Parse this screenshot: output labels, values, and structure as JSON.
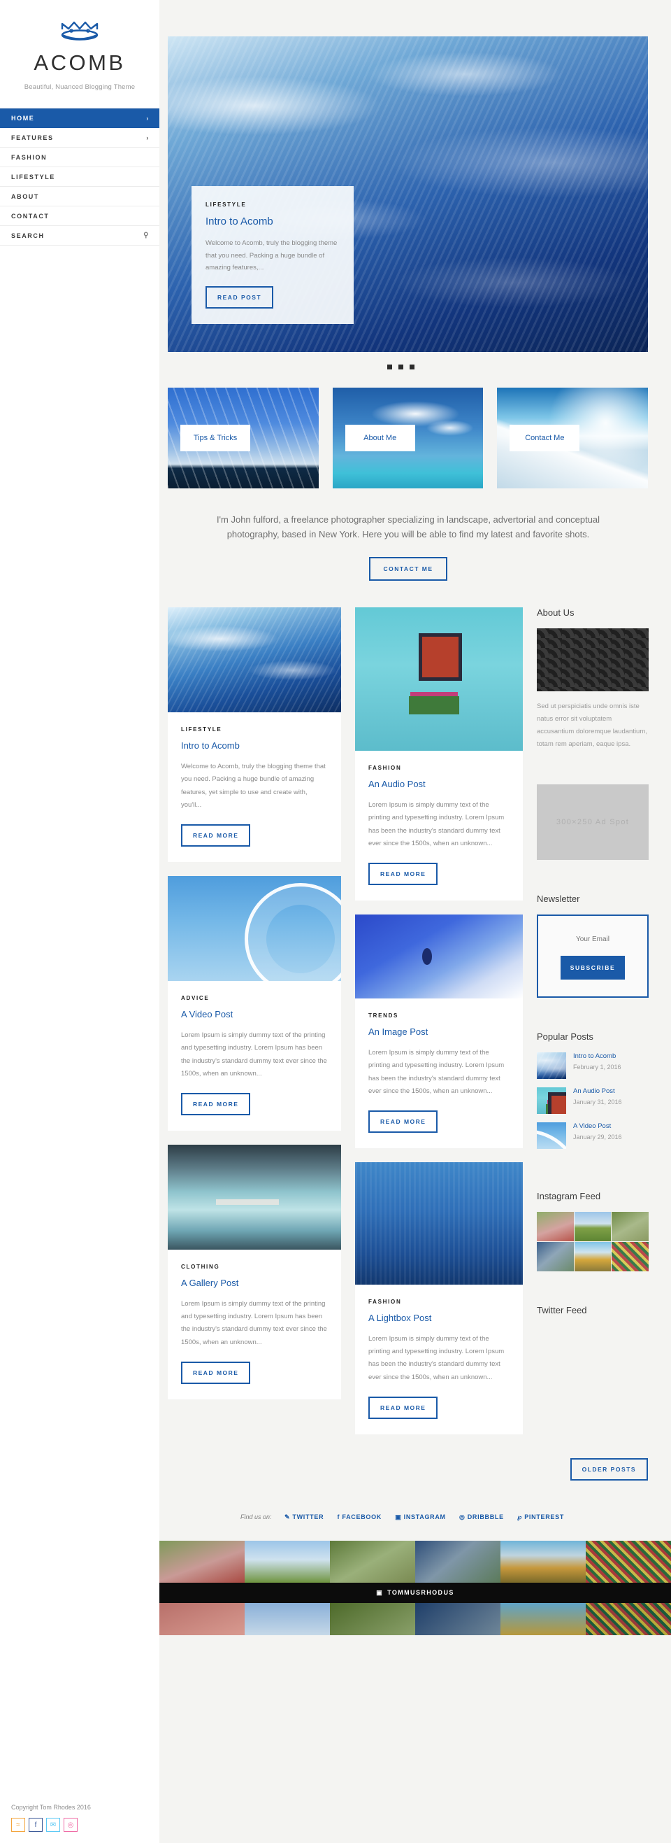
{
  "brand": {
    "title": "ACOMB",
    "tagline": "Beautiful, Nuanced Blogging Theme",
    "logo_icon": "crown-icon"
  },
  "nav": {
    "items": [
      {
        "label": "HOME",
        "active": true,
        "chevron": "›"
      },
      {
        "label": "FEATURES",
        "active": false,
        "chevron": "›"
      },
      {
        "label": "FASHION",
        "active": false,
        "chevron": ""
      },
      {
        "label": "LIFESTYLE",
        "active": false,
        "chevron": ""
      },
      {
        "label": "ABOUT",
        "active": false,
        "chevron": ""
      },
      {
        "label": "CONTACT",
        "active": false,
        "chevron": ""
      },
      {
        "label": "SEARCH",
        "active": false,
        "chevron": "",
        "icon": "search-icon"
      }
    ]
  },
  "hero": {
    "category": "LIFESTYLE",
    "title": "Intro to Acomb",
    "excerpt": "Welcome to Acomb, truly the blogging theme that you need. Packing a huge bundle of amazing features,...",
    "button": "READ POST",
    "dots": 3
  },
  "features": [
    {
      "label": "Tips & Tricks"
    },
    {
      "label": "About Me"
    },
    {
      "label": "Contact Me"
    }
  ],
  "intro": {
    "text": "I'm John fulford, a freelance photographer specializing in landscape, advertorial and conceptual photography, based in New York. Here you will be able to find my latest and favorite shots.",
    "button": "CONTACT ME"
  },
  "posts": {
    "column_a": [
      {
        "category": "LIFESTYLE",
        "title": "Intro to Acomb",
        "excerpt": "Welcome to Acomb, truly the blogging theme that you need. Packing a huge bundle of amazing features, yet simple to use and create with, you'll...",
        "button": "READ MORE",
        "image": "ocean-waves"
      },
      {
        "category": "ADVICE",
        "title": "A Video Post",
        "excerpt": "Lorem Ipsum is simply dummy text of the printing and typesetting industry. Lorem Ipsum has been the industry's standard dummy text ever since the 1500s, when an unknown...",
        "button": "READ MORE",
        "image": "ferris-wheel"
      },
      {
        "category": "CLOTHING",
        "title": "A Gallery Post",
        "excerpt": "Lorem Ipsum is simply dummy text of the printing and typesetting industry. Lorem Ipsum has been the industry's standard dummy text ever since the 1500s, when an unknown...",
        "button": "READ MORE",
        "image": "blue-lagoon"
      }
    ],
    "column_b": [
      {
        "category": "FASHION",
        "title": "An Audio Post",
        "excerpt": "Lorem Ipsum is simply dummy text of the printing and typesetting industry. Lorem Ipsum has been the industry's standard dummy text ever since the 1500s, when an unknown...",
        "button": "READ MORE",
        "image": "turquoise-wall"
      },
      {
        "category": "TRENDS",
        "title": "An Image Post",
        "excerpt": "Lorem Ipsum is simply dummy text of the printing and typesetting industry. Lorem Ipsum has been the industry's standard dummy text ever since the 1500s, when an unknown...",
        "button": "READ MORE",
        "image": "swimming-pool"
      },
      {
        "category": "FASHION",
        "title": "A Lightbox Post",
        "excerpt": "Lorem Ipsum is simply dummy text of the printing and typesetting industry. Lorem Ipsum has been the industry's standard dummy text ever since the 1500s, when an unknown...",
        "button": "READ MORE",
        "image": "deep-sea"
      }
    ]
  },
  "widgets": {
    "about": {
      "title": "About Us",
      "image": "stadium-seats",
      "text": "Sed ut perspiciatis unde omnis iste natus error sit voluptatem accusantium doloremque laudantium, totam rem aperiam, eaque ipsa."
    },
    "ad": {
      "label": "300×250 Ad Spot"
    },
    "newsletter": {
      "title": "Newsletter",
      "placeholder": "Your Email",
      "value": "",
      "button": "SUBSCRIBE"
    },
    "popular": {
      "title": "Popular Posts",
      "items": [
        {
          "title": "Intro to Acomb",
          "date": "February 1, 2016",
          "thumb": "ocean-waves"
        },
        {
          "title": "An Audio Post",
          "date": "January 31, 2016",
          "thumb": "turquoise-wall"
        },
        {
          "title": "A Video Post",
          "date": "January 29, 2016",
          "thumb": "ferris-wheel"
        }
      ]
    },
    "instagram": {
      "title": "Instagram Feed"
    },
    "twitter": {
      "title": "Twitter Feed"
    }
  },
  "pagination": {
    "older_posts": "OLDER POSTS"
  },
  "findus": {
    "label": "Find us on:",
    "links": [
      {
        "label": "TWITTER",
        "icon": "twitter-icon",
        "glyph": "✉"
      },
      {
        "label": "FACEBOOK",
        "icon": "facebook-icon",
        "glyph": "f"
      },
      {
        "label": "INSTAGRAM",
        "icon": "instagram-icon",
        "glyph": "▣"
      },
      {
        "label": "DRIBBBLE",
        "icon": "dribbble-icon",
        "glyph": "◎"
      },
      {
        "label": "PINTEREST",
        "icon": "pinterest-icon",
        "glyph": "P"
      }
    ]
  },
  "instagram_bar": {
    "handle": "TOMMUSRHODUS",
    "icon": "instagram-icon"
  },
  "footer": {
    "copyright": "Copyright Tom Rhodes 2016",
    "social": [
      {
        "name": "rss-icon",
        "glyph": "≈",
        "cls": "rss"
      },
      {
        "name": "facebook-icon",
        "glyph": "f",
        "cls": "fb"
      },
      {
        "name": "twitter-icon",
        "glyph": "✉",
        "cls": "tw"
      },
      {
        "name": "dribbble-icon",
        "glyph": "◎",
        "cls": "db"
      }
    ]
  },
  "colors": {
    "accent": "#1a5aa8",
    "bg": "#f4f4f2",
    "text": "#4a4a4a"
  }
}
